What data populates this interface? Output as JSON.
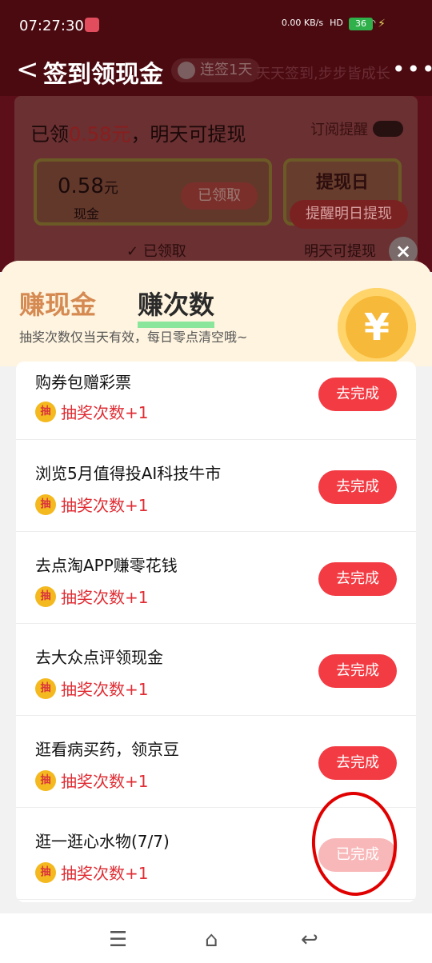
{
  "statusbar": {
    "time": "07:27:30",
    "network_speed": "0.00\nKB/s",
    "hd": "HD",
    "signal": "4G",
    "battery": "36"
  },
  "header": {
    "back_label": "<",
    "title": "签到领现金",
    "streak": "连签1天",
    "slogan": "天天签到,步步皆成长",
    "more": "•••"
  },
  "cash": {
    "line_prefix": "已领",
    "amount": "0.58元",
    "line_suffix": "，明天可提现",
    "subscribe": "订阅提醒",
    "card_value": "0.58",
    "card_unit": "元",
    "card_label": "现金",
    "claimed_btn": "已领取",
    "withdraw_day": "提现日",
    "remind_btn": "提醒明日提现",
    "status_claimed": "已领取",
    "status_tomorrow": "明天可提现"
  },
  "sheet": {
    "tab_cash": "赚现金",
    "tab_times": "赚次数",
    "hint": "抽奖次数仅当天有效，每日零点清空哦~",
    "items": [
      {
        "name": "购券包赠彩票",
        "reward": "抽奖次数+1",
        "button": "去完成"
      },
      {
        "name": "浏览5月值得投AI科技牛市",
        "reward": "抽奖次数+1",
        "button": "去完成"
      },
      {
        "name": "去点淘APP赚零花钱",
        "reward": "抽奖次数+1",
        "button": "去完成"
      },
      {
        "name": "去大众点评领现金",
        "reward": "抽奖次数+1",
        "button": "去完成"
      },
      {
        "name": "逛看病买药，领京豆",
        "reward": "抽奖次数+1",
        "button": "去完成"
      },
      {
        "name": "逛一逛心水物(7/7)",
        "reward": "抽奖次数+1",
        "button": "已完成"
      }
    ],
    "badge_text": "抽"
  },
  "nav": {
    "menu": "☰",
    "home": "⌂",
    "back": "↩"
  }
}
